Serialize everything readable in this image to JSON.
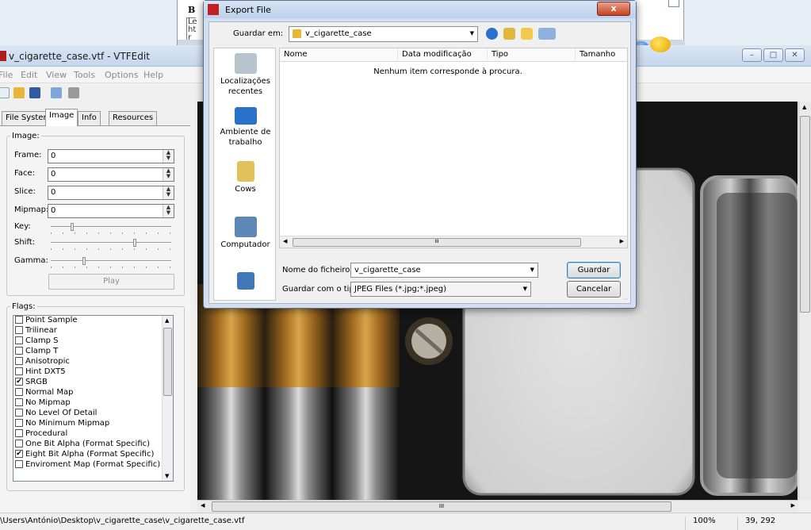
{
  "background_window": {
    "bold_letter": "B",
    "fragment_text": "Le\nht\nr"
  },
  "app": {
    "title": "v_cigarette_case.vtf - VTFEdit",
    "menu": [
      "File",
      "Edit",
      "View",
      "Tools",
      "Options",
      "Help"
    ],
    "tabs": [
      "File System",
      "Image",
      "Info",
      "Resources"
    ],
    "image_group": {
      "legend": "Image:",
      "fields": [
        {
          "label": "Frame:",
          "value": "0"
        },
        {
          "label": "Face:",
          "value": "0"
        },
        {
          "label": "Slice:",
          "value": "0"
        },
        {
          "label": "Mipmap:",
          "value": "0"
        }
      ],
      "sliders": [
        {
          "label": "Key:",
          "level": 0.17
        },
        {
          "label": "Shift:",
          "level": 0.7
        },
        {
          "label": "Gamma:",
          "level": 0.27
        }
      ],
      "play_label": "Play"
    },
    "flags_group": {
      "legend": "Flags:",
      "items": [
        {
          "label": "Point Sample",
          "checked": false
        },
        {
          "label": "Trilinear",
          "checked": false
        },
        {
          "label": "Clamp S",
          "checked": false
        },
        {
          "label": "Clamp T",
          "checked": false
        },
        {
          "label": "Anisotropic",
          "checked": false
        },
        {
          "label": "Hint DXT5",
          "checked": false
        },
        {
          "label": "SRGB",
          "checked": true
        },
        {
          "label": "Normal Map",
          "checked": false
        },
        {
          "label": "No Mipmap",
          "checked": false
        },
        {
          "label": "No Level Of Detail",
          "checked": false
        },
        {
          "label": "No Minimum Mipmap",
          "checked": false
        },
        {
          "label": "Procedural",
          "checked": false
        },
        {
          "label": "One Bit Alpha (Format Specific)",
          "checked": false
        },
        {
          "label": "Eight Bit Alpha (Format Specific)",
          "checked": true
        },
        {
          "label": "Enviroment Map (Format Specific)",
          "checked": false
        }
      ]
    },
    "statusbar": {
      "path": "\\Users\\António\\Desktop\\v_cigarette_case\\v_cigarette_case.vtf",
      "zoom": "100%",
      "coords": "39, 292"
    },
    "scroll_thumb_glyph": "III"
  },
  "dialog": {
    "title": "Export File",
    "close_glyph": "x",
    "look_in_label": "Guardar em:",
    "look_in_value": "v_cigarette_case",
    "places": [
      "Localizações recentes",
      "Ambiente de trabalho",
      "Cows",
      "Computador"
    ],
    "columns": [
      "Nome",
      "Data modificação",
      "Tipo",
      "Tamanho"
    ],
    "empty_message": "Nenhum item corresponde à procura.",
    "filename_label": "Nome do ficheiro:",
    "filename_value": "v_cigarette_case",
    "filetype_label": "Guardar com o tipo:",
    "filetype_value": "JPEG Files (*.jpg;*.jpeg)",
    "save_label": "Guardar",
    "cancel_label": "Cancelar"
  },
  "colors": {
    "accent": "#3c7fb1",
    "close": "#c6421e",
    "brass": "#c08a2a"
  }
}
